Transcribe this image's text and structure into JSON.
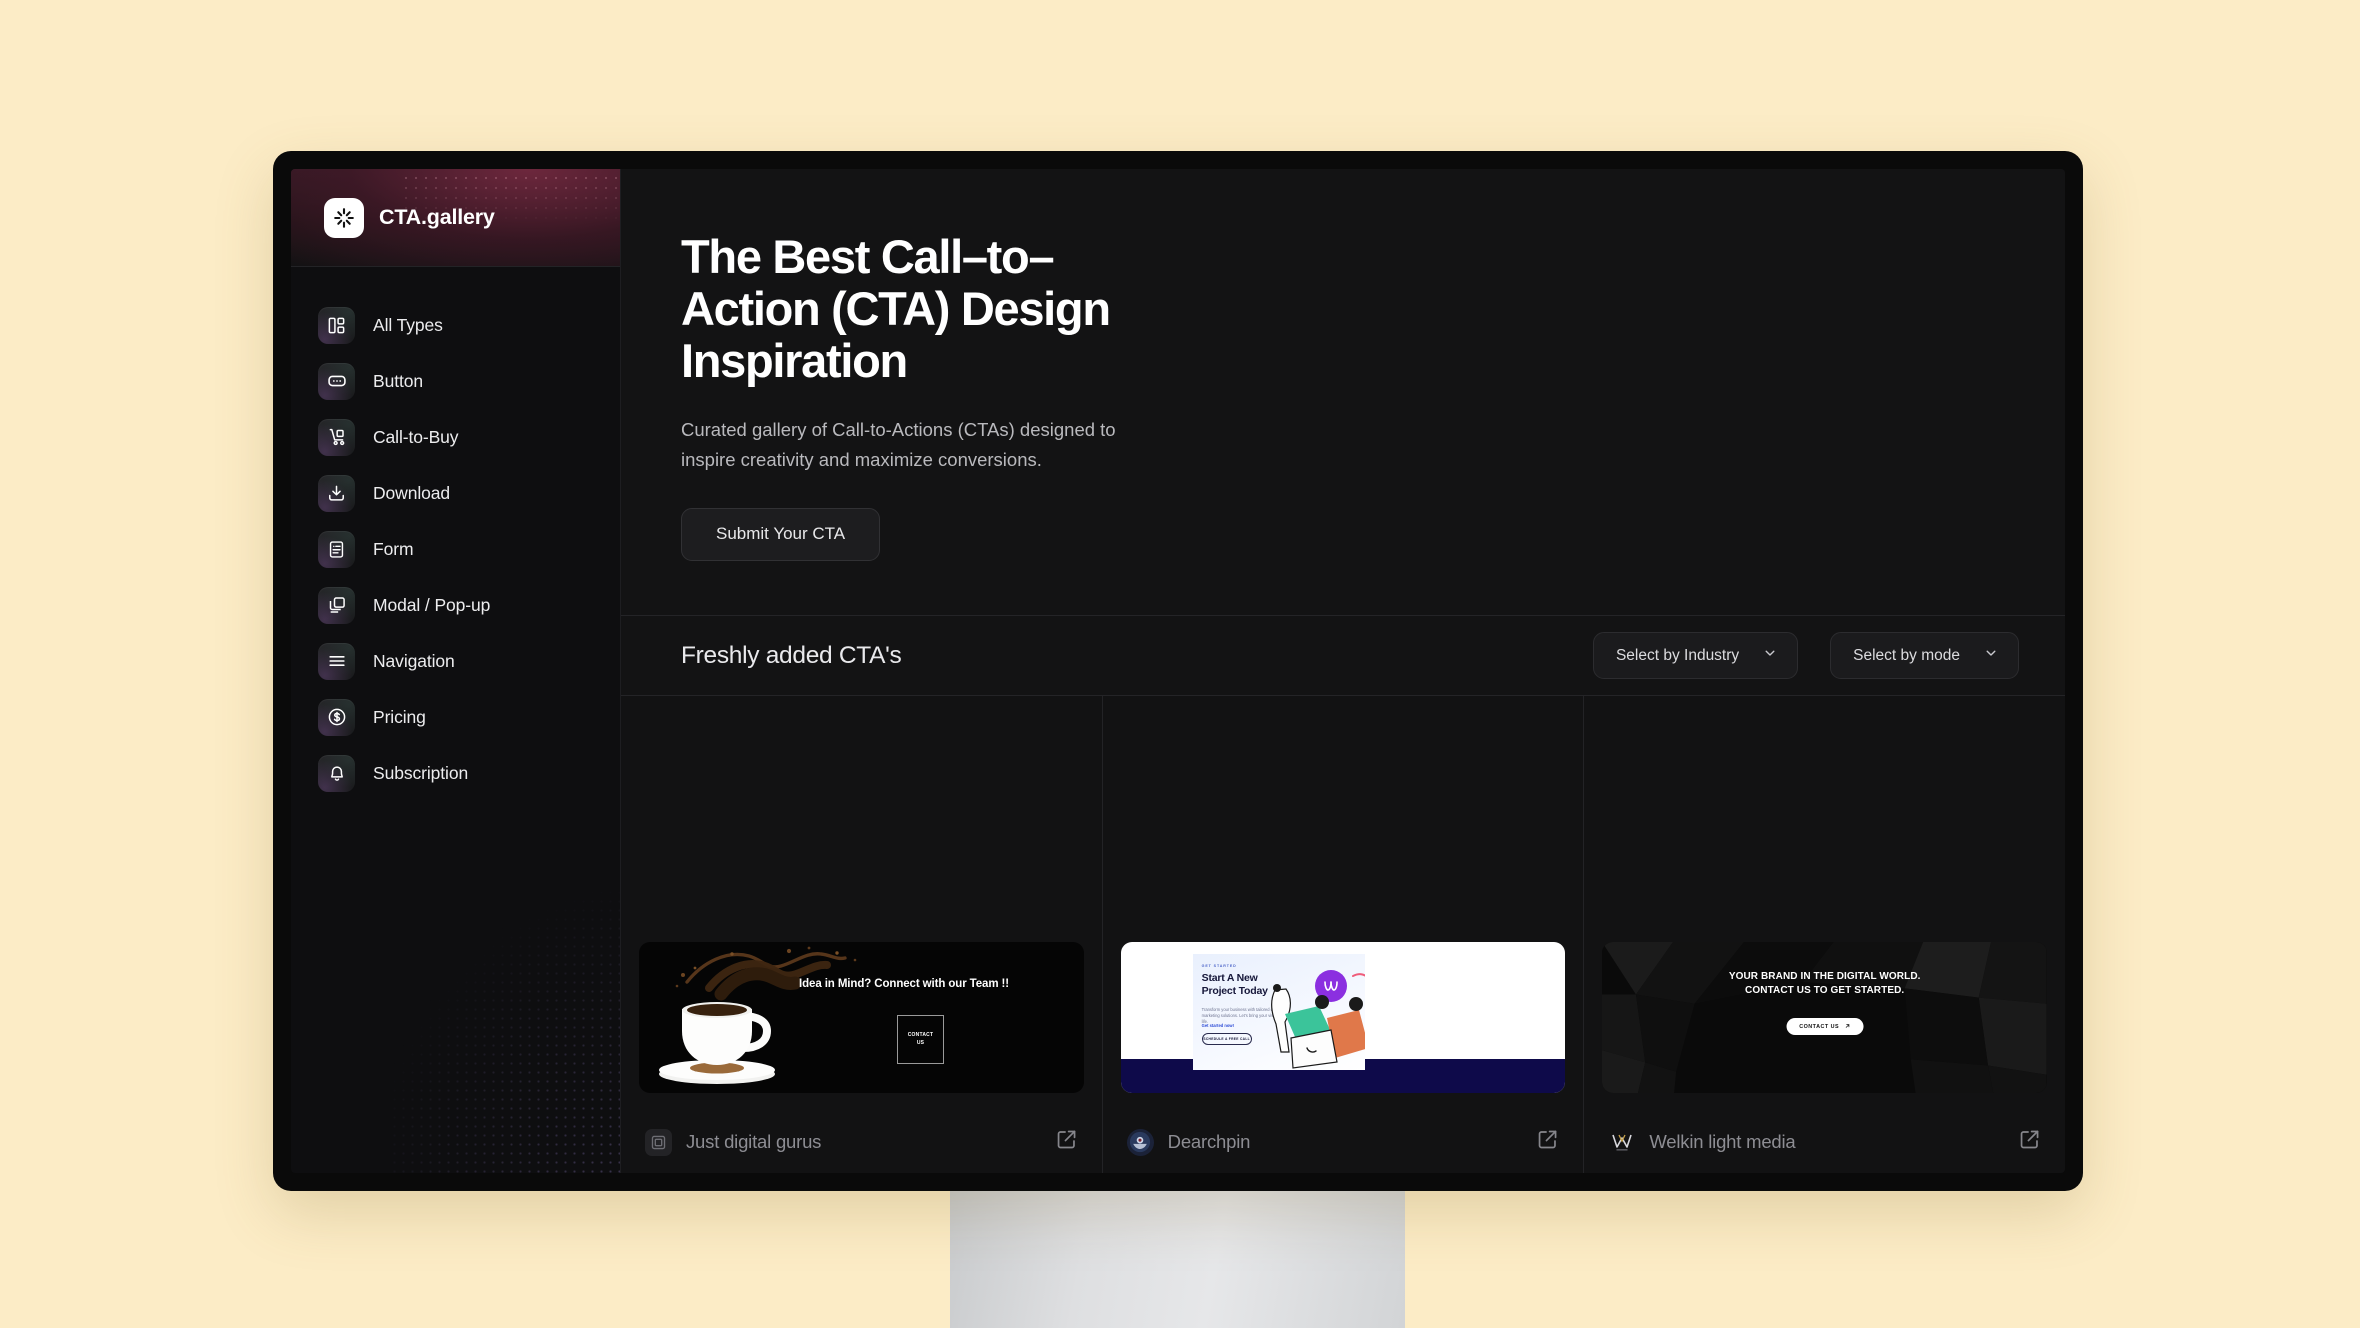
{
  "background_color": "#fcecc6",
  "brand": {
    "name": "CTA.gallery",
    "logo_icon": "asterisk-sparkle-icon"
  },
  "sidebar": {
    "items": [
      {
        "label": "All Types",
        "icon": "layout-dashboard-icon"
      },
      {
        "label": "Button",
        "icon": "button-rectangle-icon"
      },
      {
        "label": "Call-to-Buy",
        "icon": "hand-truck-cart-icon"
      },
      {
        "label": "Download",
        "icon": "download-tray-icon"
      },
      {
        "label": "Form",
        "icon": "form-document-icon"
      },
      {
        "label": "Modal / Pop-up",
        "icon": "stacked-windows-icon"
      },
      {
        "label": "Navigation",
        "icon": "hamburger-menu-icon"
      },
      {
        "label": "Pricing",
        "icon": "dollar-circle-icon"
      },
      {
        "label": "Subscription",
        "icon": "bell-icon"
      }
    ]
  },
  "hero": {
    "title": "The Best Call–to–\nAction (CTA) Design\nInspiration",
    "subtitle": "Curated gallery of Call-to-Actions (CTAs) designed to\ninspire creativity and maximize conversions.",
    "cta_label": "Submit Your CTA"
  },
  "filter_bar": {
    "section_title": "Freshly added CTA's",
    "filters": [
      {
        "label": "Select by Industry",
        "icon": "chevron-down-icon"
      },
      {
        "label": "Select by mode",
        "icon": "chevron-down-icon"
      }
    ]
  },
  "gallery": {
    "cards": [
      {
        "title": "Just digital gurus",
        "avatar_icon": "jdg-monogram-icon",
        "open_icon": "external-link-icon",
        "preview": {
          "headline": "Idea in Mind? Connect with our Team !!",
          "button_label": "CONTACT\nUS"
        }
      },
      {
        "title": "Dearchpin",
        "avatar_icon": "dearchpin-crest-icon",
        "open_icon": "external-link-icon",
        "preview": {
          "kicker": "GET STARTED",
          "headline": "Start A New\nProject Today",
          "paragraph": "Transform your business with tailored digital marketing solutions. Let's bring your vision to life.",
          "link_label": "Get started now!",
          "button_label": "SCHEDULE A FREE CALL"
        }
      },
      {
        "title": "Welkin light media",
        "avatar_icon": "welkin-w-monogram-icon",
        "open_icon": "external-link-icon",
        "preview": {
          "headline": "YOUR BRAND IN THE DIGITAL WORLD.\nCONTACT US TO GET STARTED.",
          "button_label": "CONTACT US",
          "button_icon": "arrow-up-right-icon"
        }
      }
    ]
  }
}
